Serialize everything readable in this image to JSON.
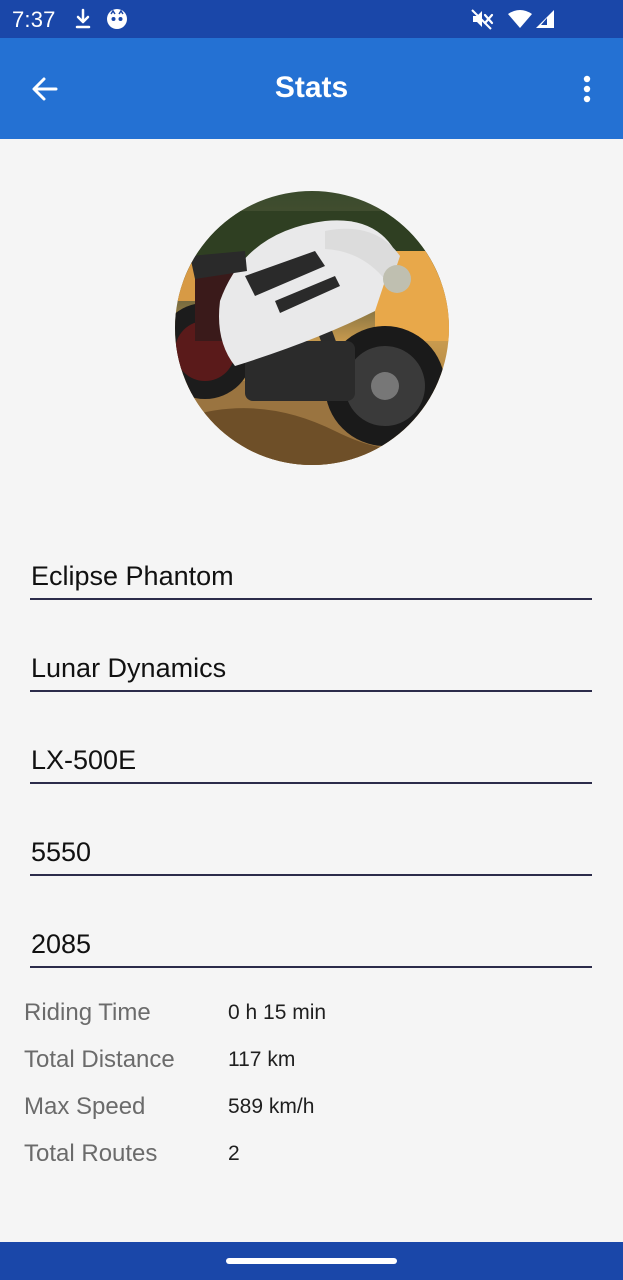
{
  "status_bar": {
    "time": "7:37",
    "icons": [
      "download-icon",
      "notification-face-icon",
      "vibrate-off-icon",
      "wifi-icon",
      "cellular-signal-icon"
    ],
    "background": "#1a47a9"
  },
  "app_bar": {
    "title": "Stats",
    "back_icon": "arrow-left-icon",
    "menu_icon": "more-vertical-icon",
    "background": "#2471d3"
  },
  "vehicle": {
    "image": "motorcycle-photo",
    "fields": [
      {
        "value": "Eclipse Phantom"
      },
      {
        "value": "Lunar Dynamics"
      },
      {
        "value": "LX-500E"
      },
      {
        "value": "5550"
      },
      {
        "value": "2085"
      }
    ]
  },
  "stats": [
    {
      "label": "Riding Time",
      "value": "0 h 15 min"
    },
    {
      "label": "Total Distance",
      "value": "117 km"
    },
    {
      "label": "Max Speed",
      "value": "589 km/h"
    },
    {
      "label": "Total Routes",
      "value": "2"
    }
  ]
}
